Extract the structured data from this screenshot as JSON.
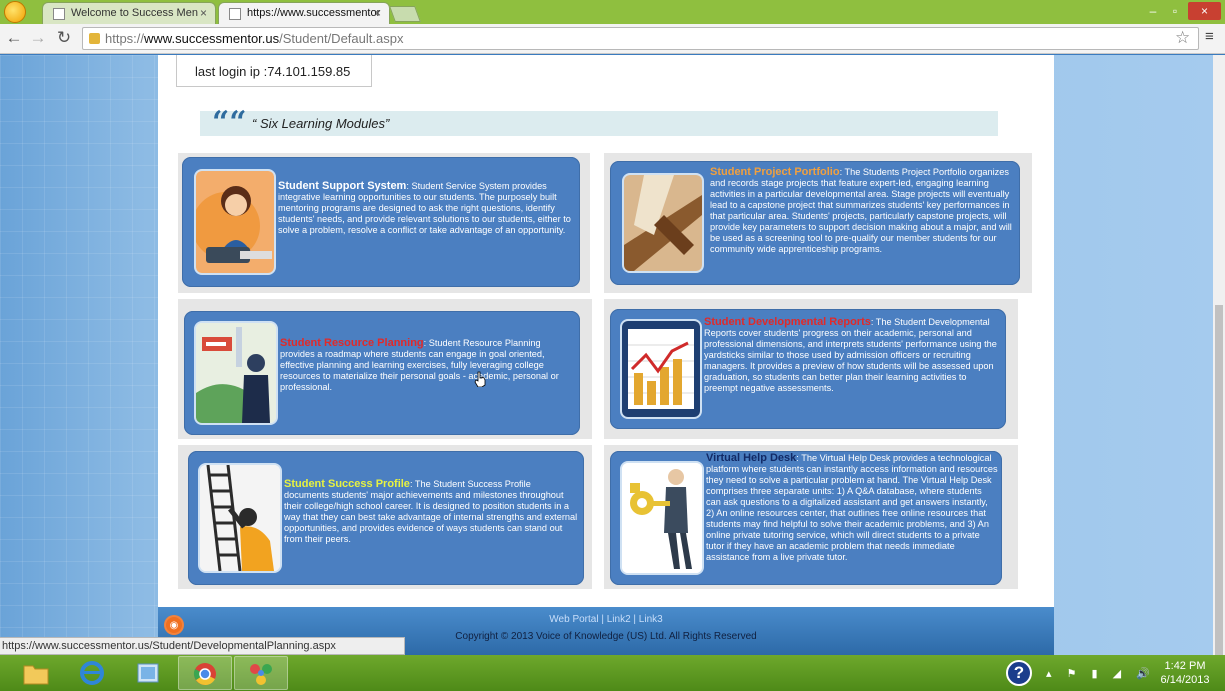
{
  "browser": {
    "tabs": [
      {
        "label": "Welcome to Success Men",
        "close": "×"
      },
      {
        "label": "https://www.successmentor",
        "close": "×"
      }
    ],
    "window_buttons": {
      "minimize": "–",
      "maximize": "▫",
      "close": "×"
    },
    "nav": {
      "back": "←",
      "forward": "→",
      "reload": "↻"
    },
    "url": {
      "scheme": "https://",
      "domain": "www.successmentor.us",
      "path": "/Student/Default.aspx"
    },
    "star": "☆",
    "menu": "≡",
    "status_url": "https://www.successmentor.us/Student/DevelopmentalPlanning.aspx"
  },
  "page": {
    "last_login": "last login ip :74.101.159.85",
    "quote_mark": "““",
    "section_title": "“ Six Learning Modules”",
    "modules": [
      {
        "title": "Student Support System",
        "text": ": Student Service System provides integrative learning opportunities to our students. The purposely built mentoring programs are designed to ask the right questions, identify students' needs, and provide relevant solutions to our students, either to solve a problem, resolve a conflict or take advantage of an opportunity."
      },
      {
        "title": "Student Project Portfolio",
        "text": ": The Students Project Portfolio organizes and records stage projects that feature expert-led, engaging learning activities in a particular developmental area. Stage projects will eventually lead to a capstone project that summarizes students' key performances in that particular area. Students' projects, particularly capstone projects, will provide key parameters to support decision making about a major, and will be used as a screening tool to pre-qualify our member students for our community wide apprenticeship programs."
      },
      {
        "title": "Student Resource Planning",
        "text": ": Student Resource Planning provides a roadmap where students can engage in goal oriented, effective planning and learning exercises, fully leveraging college resources to materialize their personal goals - academic, personal or professional."
      },
      {
        "title": "Student Developmental Reports",
        "text": ": The Student Developmental Reports cover students' progress on their academic, personal and professional dimensions, and interprets students' performance using the yardsticks similar to those used by admission officers or recruiting managers. It provides a preview of how students will be assessed upon graduation, so students can better plan their learning activities to preempt negative assessments."
      },
      {
        "title": "Student Success Profile",
        "text": ": The Student Success Profile documents students' major achievements and milestones throughout their college/high school career. It is designed to position students in a way that they can best take advantage of internal strengths and external opportunities, and provides evidence of ways students can stand out from their peers."
      },
      {
        "title": "Virtual Help Desk",
        "text": ": The Virtual Help Desk provides a technological platform where students can instantly access information and resources they need to solve a particular problem at hand. The Virtual Help Desk comprises three separate units: 1) A Q&A database, where students can ask questions to a digitalized assistant and get answers instantly, 2) An online resources center, that outlines free online resources that students may find helpful to solve their academic problems, and 3) An online private tutoring service, which will direct students to a private tutor if they have an academic problem that needs immediate assistance from a live private tutor."
      }
    ],
    "footer": {
      "links": [
        "Web Portal",
        "Link2",
        "Link3"
      ],
      "separator": " | ",
      "copyright": "Copyright © 2013 Voice of Knowledge (US) Ltd. All Rights Reserved"
    }
  },
  "taskbar": {
    "help": "?",
    "tray": "▴ ⚑ ▮ ◢ 🔊",
    "time": "1:42 PM",
    "date": "6/14/2013"
  }
}
